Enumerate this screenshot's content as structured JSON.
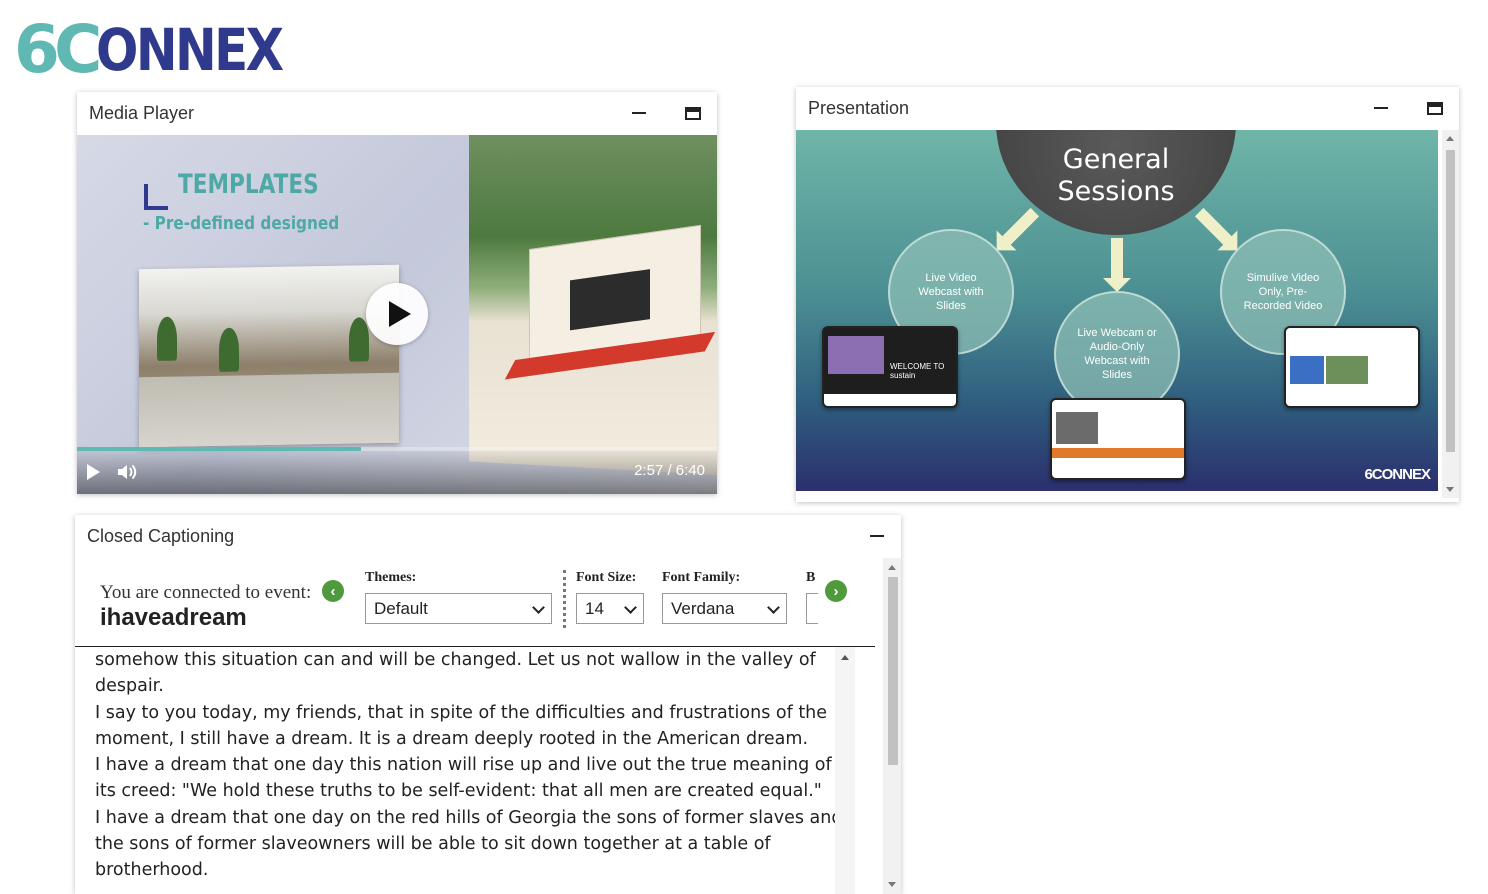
{
  "logo": {
    "part1": "6",
    "part2": "C",
    "part3": "ONNEX"
  },
  "media_player": {
    "title": "Media Player",
    "video": {
      "heading": "TEMPLATES",
      "subheading": "- Pre-defined designed",
      "time": "2:57 / 6:40",
      "progress_fraction": 0.443
    }
  },
  "presentation": {
    "title": "Presentation",
    "slide": {
      "main": "General Sessions",
      "node1": "Live Video Webcast with Slides",
      "node2": "Live Webcam or Audio-Only Webcast with Slides",
      "node3": "Simulive Video Only, Pre-Recorded Video",
      "brand": "6CONNEX",
      "thumb_text": "WELCOME TO sustain"
    }
  },
  "closed_captioning": {
    "title": "Closed Captioning",
    "connected_label": "You are connected to event:",
    "event_name": "ihaveadream",
    "themes_label": "Themes:",
    "themes_value": "Default",
    "font_size_label": "Font Size:",
    "font_size_value": "14",
    "font_family_label": "Font Family:",
    "font_family_value": "Verdana",
    "next_label_partial": "B",
    "transcript": [
      "somehow this situation can and will be changed. Let us not wallow in the valley of despair.",
      "I say to you today, my friends, that in spite of the difficulties and frustrations of the moment, I still have a dream. It is a dream deeply rooted in the American dream.",
      "I have a dream that one day this nation will rise up and live out the true meaning of its creed: \"We hold these truths to be self-evident: that all men are created equal.\"",
      "I have a dream that one day on the red hills of Georgia the sons of former slaves and the sons of former slaveowners will be able to sit down together at a table of brotherhood."
    ]
  },
  "colors": {
    "teal": "#5fb9b2",
    "navy": "#2f3a8c",
    "green_nav": "#4f9a3c"
  }
}
